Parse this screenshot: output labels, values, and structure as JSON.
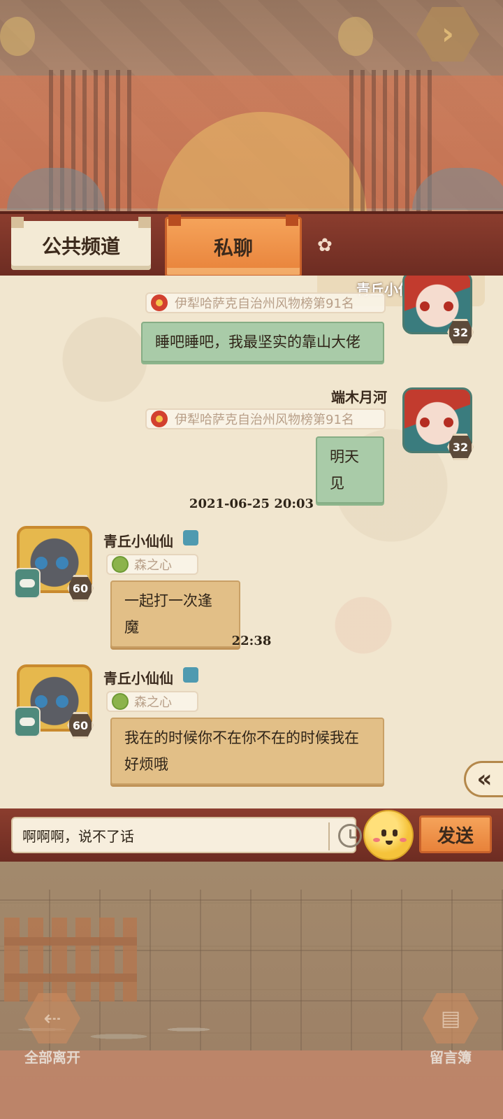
{
  "tabs": {
    "public": "公共频道",
    "private": "私聊"
  },
  "messages": [
    {
      "sender": "青丘小仙仙",
      "rank": "伊犁哈萨克自治州风物榜第91名",
      "text": "睡吧睡吧，我最坚实的靠山大佬",
      "level": "32",
      "side": "right"
    },
    {
      "sender": "端木月河",
      "rank": "伊犁哈萨克自治州风物榜第91名",
      "text": "明天见",
      "level": "32",
      "side": "right"
    },
    {
      "time": "2021-06-25 20:03",
      "sender": "青丘小仙仙",
      "badge": "森之心",
      "text": "一起打一次逢魔",
      "level": "60",
      "side": "left"
    },
    {
      "time": "22:38",
      "sender": "青丘小仙仙",
      "badge": "森之心",
      "text_line1": "我在的时候你不在你不在的时候我在",
      "text_line2": "好烦哦",
      "level": "60",
      "side": "left"
    }
  ],
  "input": {
    "value": "啊啊啊，说不了话",
    "send_label": "发送"
  },
  "bottom_actions": {
    "leave_all": "全部离开",
    "guestbook": "留言簿"
  },
  "icons": {
    "next": "chevron-right-icon",
    "flower": "flower-icon",
    "scroll": "double-chevron-left-icon",
    "history": "clock-icon",
    "emoji": "emoji-icon"
  },
  "colors": {
    "accent_orange": "#e8823a",
    "bar_red": "#7a3326",
    "bubble_green": "#a9cba8",
    "bubble_tan": "#e2bf87",
    "chat_bg": "#f1e6cf"
  }
}
